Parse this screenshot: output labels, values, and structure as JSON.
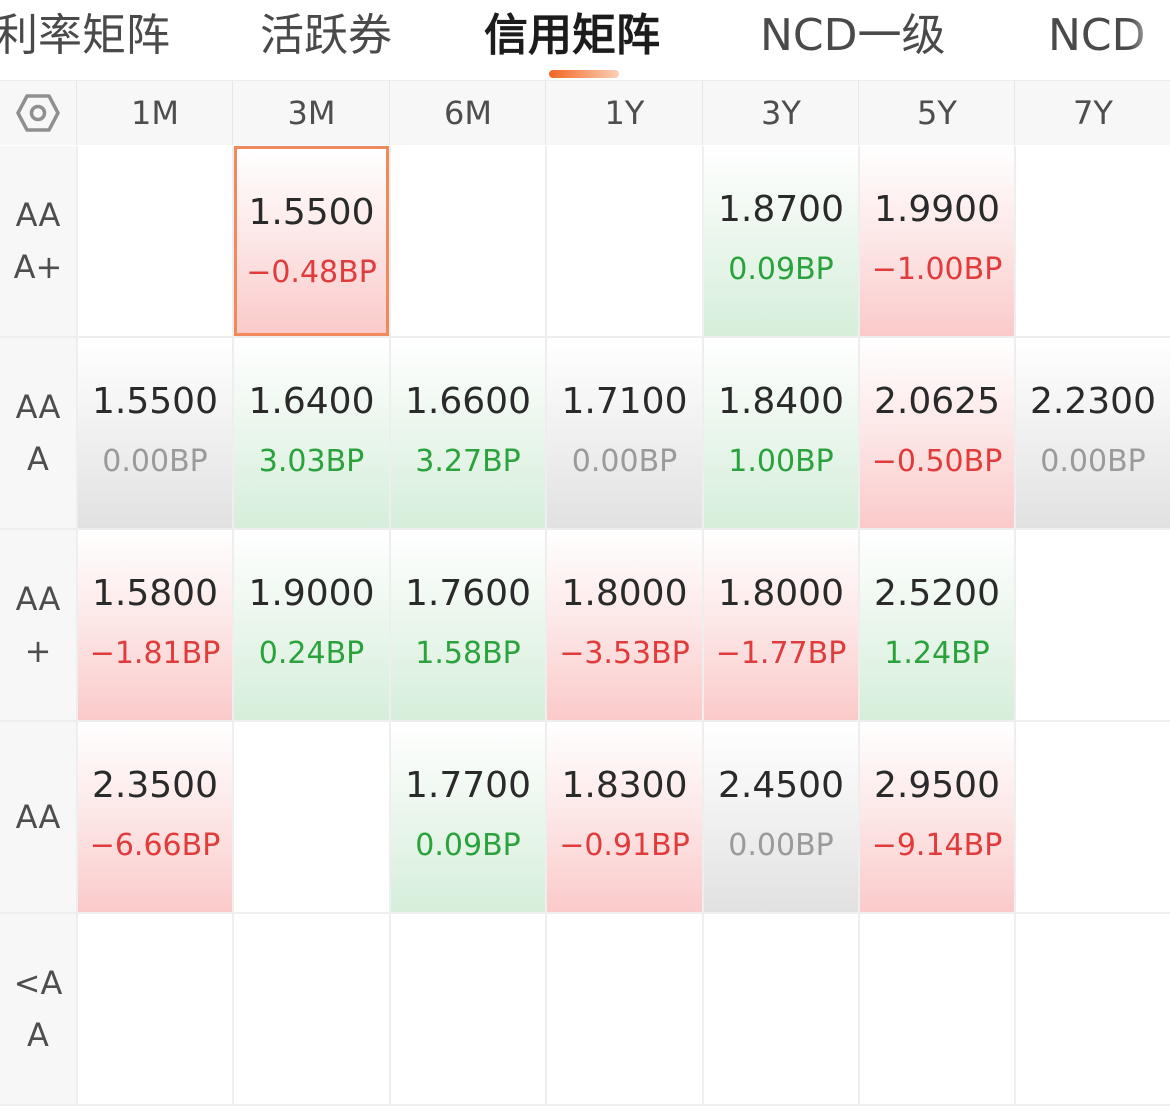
{
  "tabs": [
    {
      "label": "利率矩阵",
      "active": false
    },
    {
      "label": "活跃券",
      "active": false
    },
    {
      "label": "信用矩阵",
      "active": true
    },
    {
      "label": "NCD一级",
      "active": false
    },
    {
      "label": "NCD",
      "active": false
    }
  ],
  "settings_icon": "hexagon-settings-icon",
  "columns": [
    "1M",
    "3M",
    "6M",
    "1Y",
    "3Y",
    "5Y",
    "7Y"
  ],
  "rows": [
    {
      "label": "AAA+",
      "cells": [
        null,
        {
          "value": "1.5500",
          "change": "−0.48BP",
          "trend": "up",
          "selected": true
        },
        null,
        null,
        {
          "value": "1.8700",
          "change": "0.09BP",
          "trend": "down"
        },
        {
          "value": "1.9900",
          "change": "−1.00BP",
          "trend": "up"
        },
        null
      ]
    },
    {
      "label": "AAA",
      "cells": [
        {
          "value": "1.5500",
          "change": "0.00BP",
          "trend": "flat"
        },
        {
          "value": "1.6400",
          "change": "3.03BP",
          "trend": "down"
        },
        {
          "value": "1.6600",
          "change": "3.27BP",
          "trend": "down"
        },
        {
          "value": "1.7100",
          "change": "0.00BP",
          "trend": "flat"
        },
        {
          "value": "1.8400",
          "change": "1.00BP",
          "trend": "down"
        },
        {
          "value": "2.0625",
          "change": "−0.50BP",
          "trend": "up"
        },
        {
          "value": "2.2300",
          "change": "0.00BP",
          "trend": "flat"
        }
      ]
    },
    {
      "label": "AA+",
      "cells": [
        {
          "value": "1.5800",
          "change": "−1.81BP",
          "trend": "up"
        },
        {
          "value": "1.9000",
          "change": "0.24BP",
          "trend": "down"
        },
        {
          "value": "1.7600",
          "change": "1.58BP",
          "trend": "down"
        },
        {
          "value": "1.8000",
          "change": "−3.53BP",
          "trend": "up"
        },
        {
          "value": "1.8000",
          "change": "−1.77BP",
          "trend": "up"
        },
        {
          "value": "2.5200",
          "change": "1.24BP",
          "trend": "down"
        },
        null
      ]
    },
    {
      "label": "AA",
      "cells": [
        {
          "value": "2.3500",
          "change": "−6.66BP",
          "trend": "up"
        },
        null,
        {
          "value": "1.7700",
          "change": "0.09BP",
          "trend": "down"
        },
        {
          "value": "1.8300",
          "change": "−0.91BP",
          "trend": "up"
        },
        {
          "value": "2.4500",
          "change": "0.00BP",
          "trend": "flat"
        },
        {
          "value": "2.9500",
          "change": "−9.14BP",
          "trend": "up"
        },
        null
      ]
    },
    {
      "label": "<AA",
      "cells": [
        null,
        null,
        null,
        null,
        null,
        null,
        null
      ]
    }
  ],
  "colors": {
    "accent": "#f26522",
    "up_text": "#e03c3c",
    "down_text": "#2aa33c",
    "flat_text": "#9a9a9a",
    "selected_border": "#f08a5d"
  }
}
